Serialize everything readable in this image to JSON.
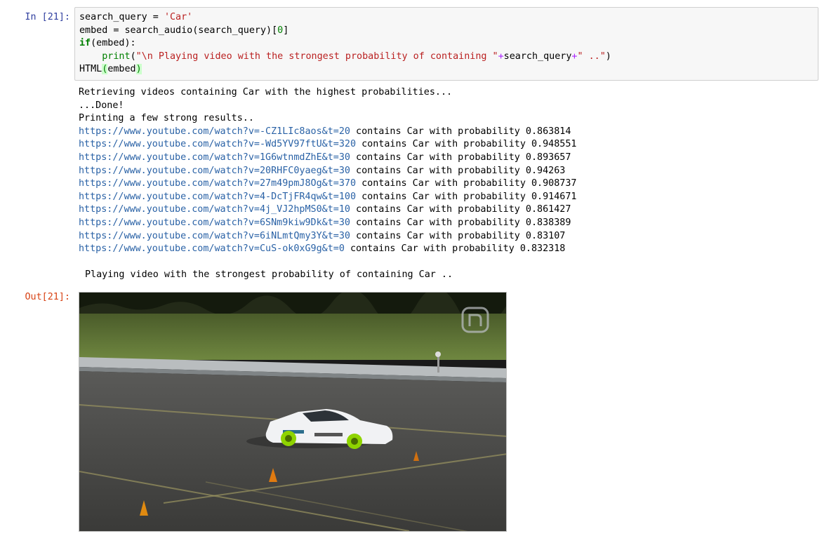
{
  "cell": {
    "in_prompt": "In [21]:",
    "out_prompt": "Out[21]:",
    "code": {
      "line1": {
        "var": "search_query",
        "eq": " = ",
        "str": "'Car'"
      },
      "line2": {
        "var": "embed",
        "eq": " = ",
        "call": "search_audio(search_query)[",
        "num": "0",
        "close": "]"
      },
      "line3": {
        "kw": "if",
        "rest": "(embed):"
      },
      "line4": {
        "indent": "    ",
        "fn": "print",
        "open": "(",
        "str1": "\"\\n Playing video with the strongest probability of containing \"",
        "op1": "+",
        "mid": "search_query",
        "op2": "+",
        "str2": "\" ..\"",
        "close": ")"
      },
      "line5": {
        "fn": "HTML",
        "open": "(",
        "arg": "embed",
        "close": ")"
      }
    },
    "output": {
      "line1": "Retrieving videos containing Car with the highest probabilities...",
      "line2": "...Done!",
      "line3": "Printing a few strong results..",
      "results": [
        {
          "url": "https://www.youtube.com/watch?v=-CZ1LIc8aos&t=20",
          "text": " contains Car with probability 0.863814"
        },
        {
          "url": "https://www.youtube.com/watch?v=-Wd5YV97ftU&t=320",
          "text": " contains Car with probability 0.948551"
        },
        {
          "url": "https://www.youtube.com/watch?v=1G6wtnmdZhE&t=30",
          "text": " contains Car with probability 0.893657"
        },
        {
          "url": "https://www.youtube.com/watch?v=20RHFC0yaeg&t=30",
          "text": " contains Car with probability 0.94263"
        },
        {
          "url": "https://www.youtube.com/watch?v=27m49pmJ8Og&t=370",
          "text": " contains Car with probability 0.908737"
        },
        {
          "url": "https://www.youtube.com/watch?v=4-DcTjFR4qw&t=100",
          "text": " contains Car with probability 0.914671"
        },
        {
          "url": "https://www.youtube.com/watch?v=4j_VJ2hpMS0&t=10",
          "text": " contains Car with probability 0.861427"
        },
        {
          "url": "https://www.youtube.com/watch?v=6SNm9kiw9Dk&t=30",
          "text": " contains Car with probability 0.838389"
        },
        {
          "url": "https://www.youtube.com/watch?v=6iNLmtQmy3Y&t=30",
          "text": " contains Car with probability 0.83107"
        },
        {
          "url": "https://www.youtube.com/watch?v=CuS-ok0xG9g&t=0",
          "text": " contains Car with probability 0.832318"
        }
      ],
      "playing": "Playing video with the strongest probability of containing Car .."
    },
    "video": {
      "watermark_icon": "n-logo-icon",
      "content": "white drift car with green wheels on asphalt track with traffic cones"
    }
  }
}
